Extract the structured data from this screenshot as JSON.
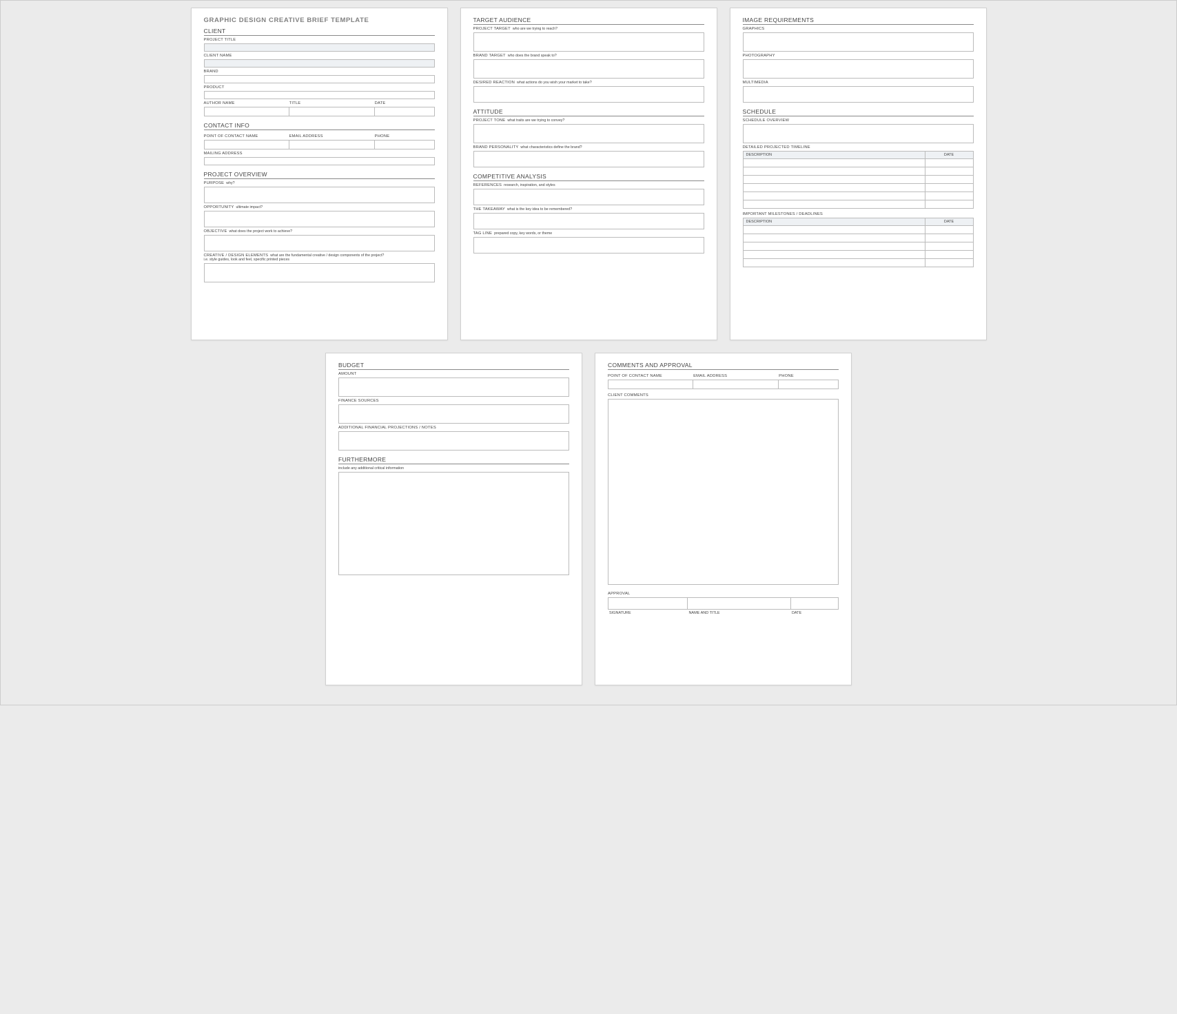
{
  "doc_title": "GRAPHIC DESIGN CREATIVE BRIEF TEMPLATE",
  "p1": {
    "s1": "CLIENT",
    "f1": "PROJECT TITLE",
    "f2": "CLIENT NAME",
    "f3": "BRAND",
    "f4": "PRODUCT",
    "f5a": "AUTHOR NAME",
    "f5b": "TITLE",
    "f5c": "DATE",
    "s2": "CONTACT INFO",
    "f6a": "POINT OF CONTACT NAME",
    "f6b": "EMAIL ADDRESS",
    "f6c": "PHONE",
    "f7": "MAILING ADDRESS",
    "s3": "PROJECT OVERVIEW",
    "f8": "PURPOSE",
    "f8h": "why?",
    "f9": "OPPORTUNITY",
    "f9h": "ultimate impact?",
    "f10": "OBJECTIVE",
    "f10h": "what does the project work to achieve?",
    "f11": "CREATIVE / DESIGN ELEMENTS",
    "f11h": "what are the fundamental creative / design components of the project?",
    "f11h2": "i.e. style guides, look and feel, specific printed pieces"
  },
  "p2": {
    "s1": "TARGET AUDIENCE",
    "f1": "PROJECT TARGET",
    "f1h": "who are we trying to reach?",
    "f2": "BRAND TARGET",
    "f2h": "who does the brand speak to?",
    "f3": "DESIRED REACTION",
    "f3h": "what actions do you wish your market to take?",
    "s2": "ATTITUDE",
    "f4": "PROJECT TONE",
    "f4h": "what traits are we trying to convey?",
    "f5": "BRAND PERSONALITY",
    "f5h": "what characteristics define the brand?",
    "s3": "COMPETITIVE ANALYSIS",
    "f6": "REFERENCES",
    "f6h": "research, inspiration, and styles",
    "f7": "THE TAKEAWAY",
    "f7h": "what is the key idea to be remembered?",
    "f8": "TAG LINE",
    "f8h": "prepared copy, key words, or theme"
  },
  "p3": {
    "s1": "IMAGE REQUIREMENTS",
    "f1": "GRAPHICS",
    "f2": "PHOTOGRAPHY",
    "f3": "MULTIMEDIA",
    "s2": "SCHEDULE",
    "f4": "SCHEDULE OVERVIEW",
    "f5": "DETAILED PROJECTED TIMELINE",
    "th1": "DESCRIPTION",
    "th2": "DATE",
    "f6": "IMPORTANT MILESTONES / DEADLINES"
  },
  "p4": {
    "s1": "BUDGET",
    "f1": "AMOUNT",
    "f2": "FINANCE SOURCES",
    "f3": "ADDITIONAL FINANCIAL PROJECTIONS / NOTES",
    "s2": "FURTHERMORE",
    "f4": "include any additional critical information"
  },
  "p5": {
    "s1": "COMMENTS AND APPROVAL",
    "f1a": "POINT OF CONTACT NAME",
    "f1b": "EMAIL ADDRESS",
    "f1c": "PHONE",
    "f2": "CLIENT COMMENTS",
    "f3": "APPROVAL",
    "sig1": "SIGNATURE",
    "sig2": "NAME AND TITLE",
    "sig3": "DATE"
  }
}
